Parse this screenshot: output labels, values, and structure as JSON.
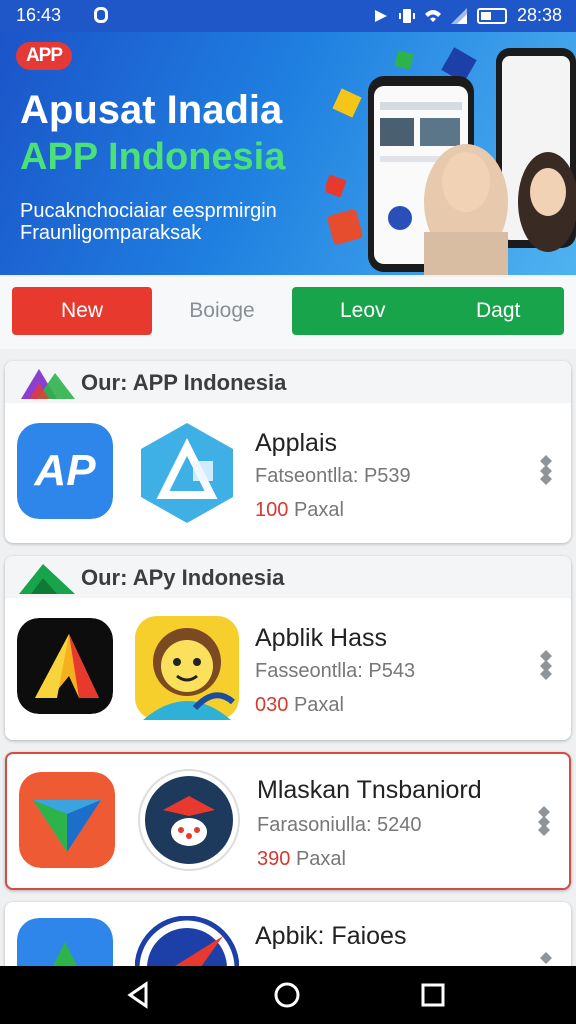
{
  "status": {
    "time": "16:43",
    "clock": "28:38"
  },
  "banner": {
    "brand": "APP",
    "title_line1": "Apusat Inadia",
    "title_line2": "APP Indonesia",
    "tagline_line1": "Pucaknchociaiar eesprmirgin",
    "tagline_line2": "Fraunligomparaksak"
  },
  "tabs": {
    "new": "New",
    "boioge": "Boioge",
    "leov": "Leov",
    "dagt": "Dagt"
  },
  "sections": [
    {
      "title": "Our: APP Indonesia"
    },
    {
      "title": "Our: APy Indonesia"
    }
  ],
  "apps": [
    {
      "name": "Applais",
      "subtitle": "Fatseontlla: P539",
      "price_num": "100",
      "price_unit": "Paxal"
    },
    {
      "name": "Apblik Hass",
      "subtitle": "Fasseontlla: P543",
      "price_num": "030",
      "price_unit": "Paxal"
    },
    {
      "name": "Mlaskan Tnsbaniord",
      "subtitle": "Farasoniulla: 5240",
      "price_num": "390",
      "price_unit": "Paxal"
    },
    {
      "name": "Apbik: Faioes"
    }
  ],
  "colors": {
    "brand_blue": "#1f56c8",
    "accent_red": "#e8392f",
    "accent_green": "#17a44a"
  }
}
